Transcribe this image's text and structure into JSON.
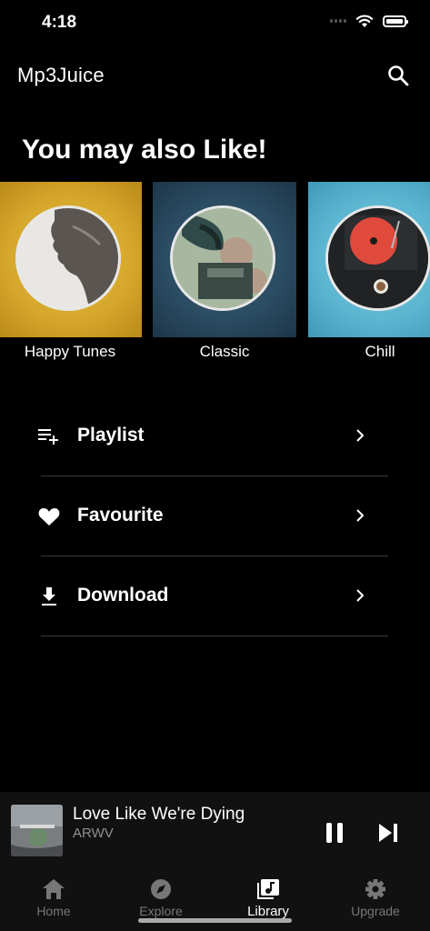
{
  "status_bar": {
    "time": "4:18"
  },
  "header": {
    "title": "Mp3Juice",
    "search_icon": "search-icon"
  },
  "section": {
    "title": "You may also Like!"
  },
  "cards": [
    {
      "label": "Happy Tunes",
      "bg": "#d4a62a"
    },
    {
      "label": "Classic",
      "bg": "#2a4a60"
    },
    {
      "label": "Chill",
      "bg": "#5ab4d0"
    }
  ],
  "menu": [
    {
      "label": "Playlist",
      "icon": "playlist-add-icon"
    },
    {
      "label": "Favourite",
      "icon": "heart-icon"
    },
    {
      "label": "Download",
      "icon": "download-icon"
    }
  ],
  "player": {
    "title": "Love Like We're Dying",
    "artist": "ARWV"
  },
  "tabs": [
    {
      "label": "Home",
      "icon": "home-icon"
    },
    {
      "label": "Explore",
      "icon": "compass-icon"
    },
    {
      "label": "Library",
      "icon": "library-icon",
      "active": true
    },
    {
      "label": "Upgrade",
      "icon": "gear-icon"
    }
  ],
  "colors": {
    "background": "#000000",
    "panel": "#111111",
    "divider": "#3a3a3a",
    "muted": "#777777"
  }
}
